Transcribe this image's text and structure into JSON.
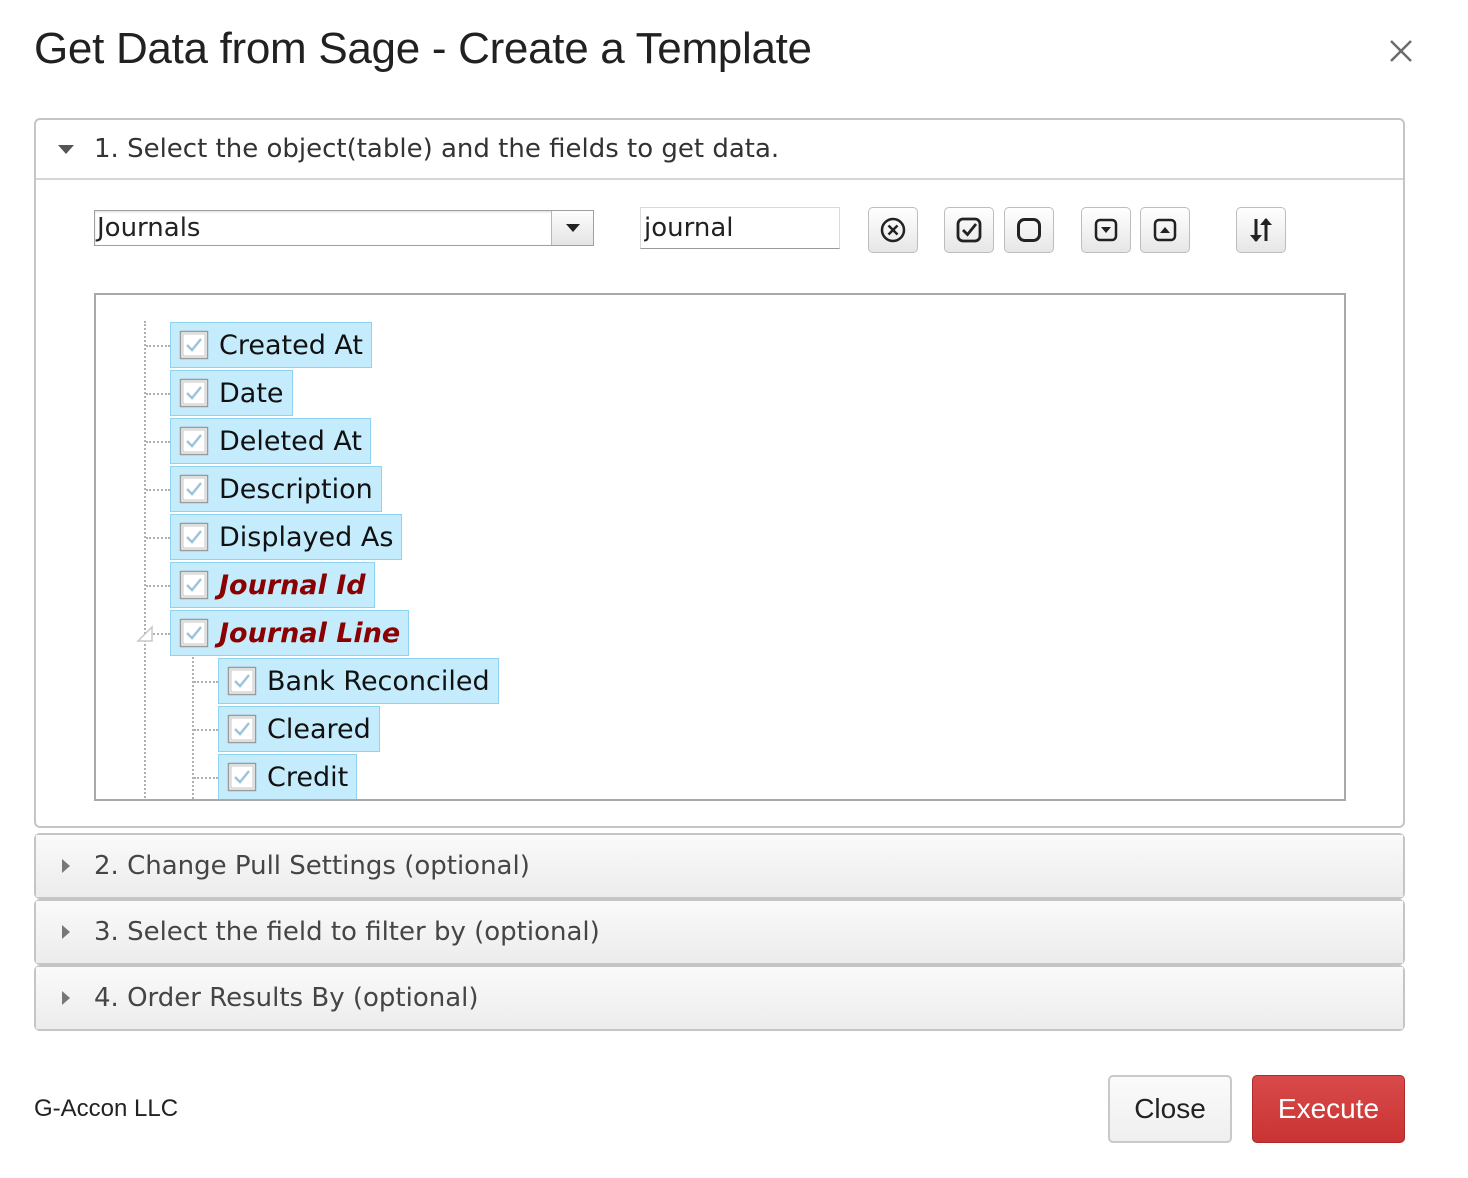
{
  "dialog": {
    "title": "Get Data from Sage - Create a Template"
  },
  "section1": {
    "header": "1. Select the object(table) and the fields to get data.",
    "object_select": {
      "value": "Journals"
    },
    "search": {
      "value": "journal"
    },
    "tools": [
      {
        "icon": "clear-circle-x-icon"
      },
      {
        "icon": "check-all-icon"
      },
      {
        "icon": "uncheck-all-icon"
      },
      {
        "icon": "expand-all-icon"
      },
      {
        "icon": "collapse-all-icon"
      },
      {
        "icon": "sort-icon"
      }
    ],
    "tree": {
      "nodes": [
        {
          "label": "Created At",
          "checked": true,
          "key": false
        },
        {
          "label": "Date",
          "checked": true,
          "key": false
        },
        {
          "label": "Deleted At",
          "checked": true,
          "key": false
        },
        {
          "label": "Description",
          "checked": true,
          "key": false
        },
        {
          "label": "Displayed As",
          "checked": true,
          "key": false
        },
        {
          "label": "Journal Id",
          "checked": true,
          "key": true
        },
        {
          "label": "Journal Line",
          "checked": true,
          "key": true,
          "expanded": true,
          "children": [
            {
              "label": "Bank Reconciled",
              "checked": true
            },
            {
              "label": "Cleared",
              "checked": true
            },
            {
              "label": "Credit",
              "checked": true
            }
          ]
        }
      ]
    }
  },
  "section2": {
    "header": "2. Change Pull Settings (optional)"
  },
  "section3": {
    "header": "3. Select the field to filter by (optional)"
  },
  "section4": {
    "header": "4. Order Results By (optional)"
  },
  "footer": {
    "brand": "G-Accon LLC",
    "close_label": "Close",
    "execute_label": "Execute",
    "execute_color": "#cc3333"
  }
}
